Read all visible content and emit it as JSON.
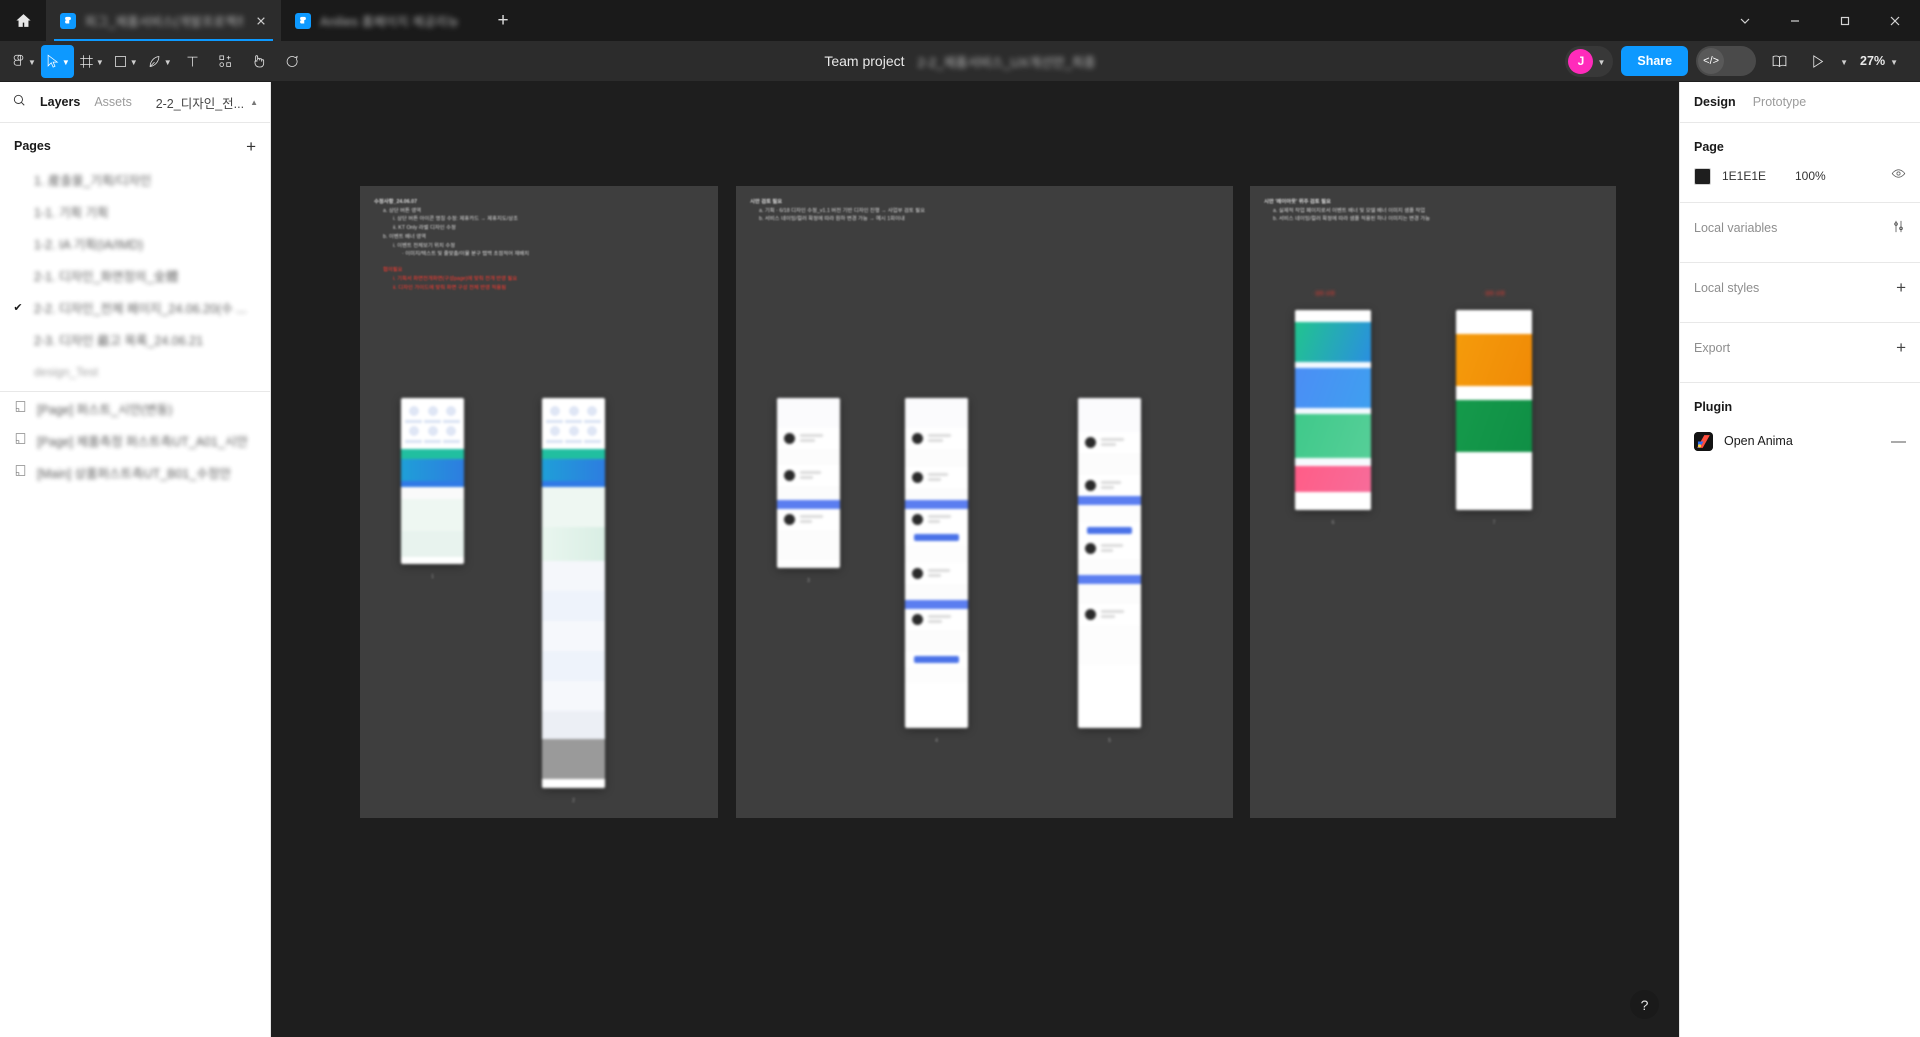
{
  "browser": {
    "home_icon": "home-icon",
    "new_tab_label": "+",
    "tabs": [
      {
        "title": "피그_제품서비스(개발프로젝트)",
        "favicon": "figma-icon",
        "active": true,
        "close_label": "×"
      },
      {
        "title": "Anilies 홈페이지 제공리뉴",
        "favicon": "figma-icon",
        "active": false,
        "close_label": "×"
      }
    ],
    "window_controls": {
      "expand": "chevron-down-icon",
      "minimize": "minimize-icon",
      "maximize": "maximize-icon",
      "close": "close-icon"
    }
  },
  "toolbar": {
    "tools": [
      {
        "name": "main-menu",
        "icon": "figma-logo-icon",
        "caret": true,
        "active": false
      },
      {
        "name": "move-tool",
        "icon": "cursor-icon",
        "caret": true,
        "active": true
      },
      {
        "name": "frame-tool",
        "icon": "frame-icon",
        "caret": true,
        "active": false
      },
      {
        "name": "shape-tool",
        "icon": "square-icon",
        "caret": true,
        "active": false
      },
      {
        "name": "pen-tool",
        "icon": "pen-icon",
        "caret": true,
        "active": false
      },
      {
        "name": "text-tool",
        "icon": "text-icon",
        "caret": false,
        "active": false
      },
      {
        "name": "actions-tool",
        "icon": "resources-icon",
        "caret": false,
        "active": false
      },
      {
        "name": "hand-tool",
        "icon": "hand-icon",
        "caret": false,
        "active": false
      },
      {
        "name": "comment-tool",
        "icon": "comment-icon",
        "caret": false,
        "active": false
      }
    ],
    "project_title": "Team project",
    "file_title": "2-2_제품서비스_UX개선안_최종",
    "user_initial": "J",
    "user_accent": "#ff2bbb",
    "share_label": "Share",
    "code_toggle_label": "</>",
    "share_accent": "#0d99ff",
    "library_icon": "book-icon",
    "present_icon": "play-icon",
    "zoom_level": "27%"
  },
  "left_panel": {
    "search_icon": "search-icon",
    "tabs": [
      {
        "label": "Layers",
        "active": true
      },
      {
        "label": "Assets",
        "active": false
      }
    ],
    "file_breadcrumb": "2-2_디자인_전...",
    "pages_header": "Pages",
    "add_page_label": "+",
    "pages": [
      {
        "name": "1. 産출물_기획/디자인",
        "selected": false
      },
      {
        "name": "1-1. 기획 기획",
        "selected": false
      },
      {
        "name": "1-2. IA 기획(IA/IMD)",
        "selected": false
      },
      {
        "name": "2-1. 디자인_화면정의_全體",
        "selected": false
      },
      {
        "name": "2-2. 디자인_전체 페이지_24.06.20(수 ...",
        "selected": true
      },
      {
        "name": "2-3. 디자인 最고 목록_24.06.21",
        "selected": false
      }
    ],
    "section_label": "design_Test",
    "layers": [
      {
        "name": "[Page] 퍼스트_시안(변동)",
        "icon": "page-icon"
      },
      {
        "name": "[Page] 제품측정 퍼스트측UT_A01_시안",
        "icon": "page-icon"
      },
      {
        "name": "[Main] 상품퍼스트측UT_B01_수정안",
        "icon": "page-icon"
      }
    ]
  },
  "canvas": {
    "frames": [
      {
        "name": "frame-1",
        "notes": [
          {
            "text": "수정사항_24.06.07",
            "level": 1,
            "red": false
          },
          {
            "text": "a. 상단 버튼 영역",
            "level": 2,
            "red": false
          },
          {
            "text": "i. 상단 버튼 아이콘 명칭 수정: 제휴카드 → 제휴지도/상조",
            "level": 3,
            "red": false
          },
          {
            "text": "ii. KT Only 라벨 디자인 수정",
            "level": 3,
            "red": false
          },
          {
            "text": "b. 이벤트 배너 영역",
            "level": 2,
            "red": false
          },
          {
            "text": "i. 이벤트 전체보기 위치 수정",
            "level": 3,
            "red": false
          },
          {
            "text": "· 이미지/텍스트 및 줄맞춤/이물 분구 탭백 초점적어 재배치",
            "level": 4,
            "red": false
          },
          {
            "text": "협의필요",
            "level": 2,
            "red": true
          },
          {
            "text": "i. 기획서 화면전개화면(구성page)에 맞춰 전개 반영 필요",
            "level": 3,
            "red": true
          },
          {
            "text": "ii. 디자인 가이드에 맞춰 화면 구성 전체 반영 적용됨",
            "level": 3,
            "red": true
          }
        ]
      },
      {
        "name": "frame-2",
        "notes": [
          {
            "text": "시안 검토 필요",
            "level": 1,
            "red": false
          },
          {
            "text": "a. 기획 · 6/18 디자인 수정_v1.1 버전 기반 디자인 진행 → 사업부 검토 필요",
            "level": 2,
            "red": false
          },
          {
            "text": "b. 서비스 네이밍/컬러 확정에 따라 원하 변경 가능 → 예시 1회이내",
            "level": 2,
            "red": false
          }
        ]
      },
      {
        "name": "frame-3",
        "notes": [
          {
            "text": "시안 '레이아웃' 위주 검토 필요",
            "level": 1,
            "red": false
          },
          {
            "text": "a. 실제적 작업 페이지로서 이벤트 배너 및 모델 배너 이미지 샘플 작업",
            "level": 2,
            "red": false
          },
          {
            "text": "b. 서비스 네이밍/컬러 확정에 따라 샘플 적용된 하나 이미지는 변경 가능",
            "level": 2,
            "red": false
          }
        ]
      }
    ]
  },
  "right_panel": {
    "tabs": [
      {
        "label": "Design",
        "active": true
      },
      {
        "label": "Prototype",
        "active": false
      }
    ],
    "page_section": {
      "title": "Page",
      "color_hex": "1E1E1E",
      "color_value": "#1E1E1E",
      "opacity": "100%",
      "visibility_icon": "eye-icon"
    },
    "rows": [
      {
        "label": "Local variables",
        "action": "sliders-icon"
      },
      {
        "label": "Local styles",
        "action": "+"
      },
      {
        "label": "Export",
        "action": "+"
      }
    ],
    "plugin_section": {
      "title": "Plugin",
      "plugin_name": "Open Anima",
      "collapse_label": "—",
      "icon": "anima-icon"
    }
  },
  "help_button": {
    "label": "?"
  }
}
